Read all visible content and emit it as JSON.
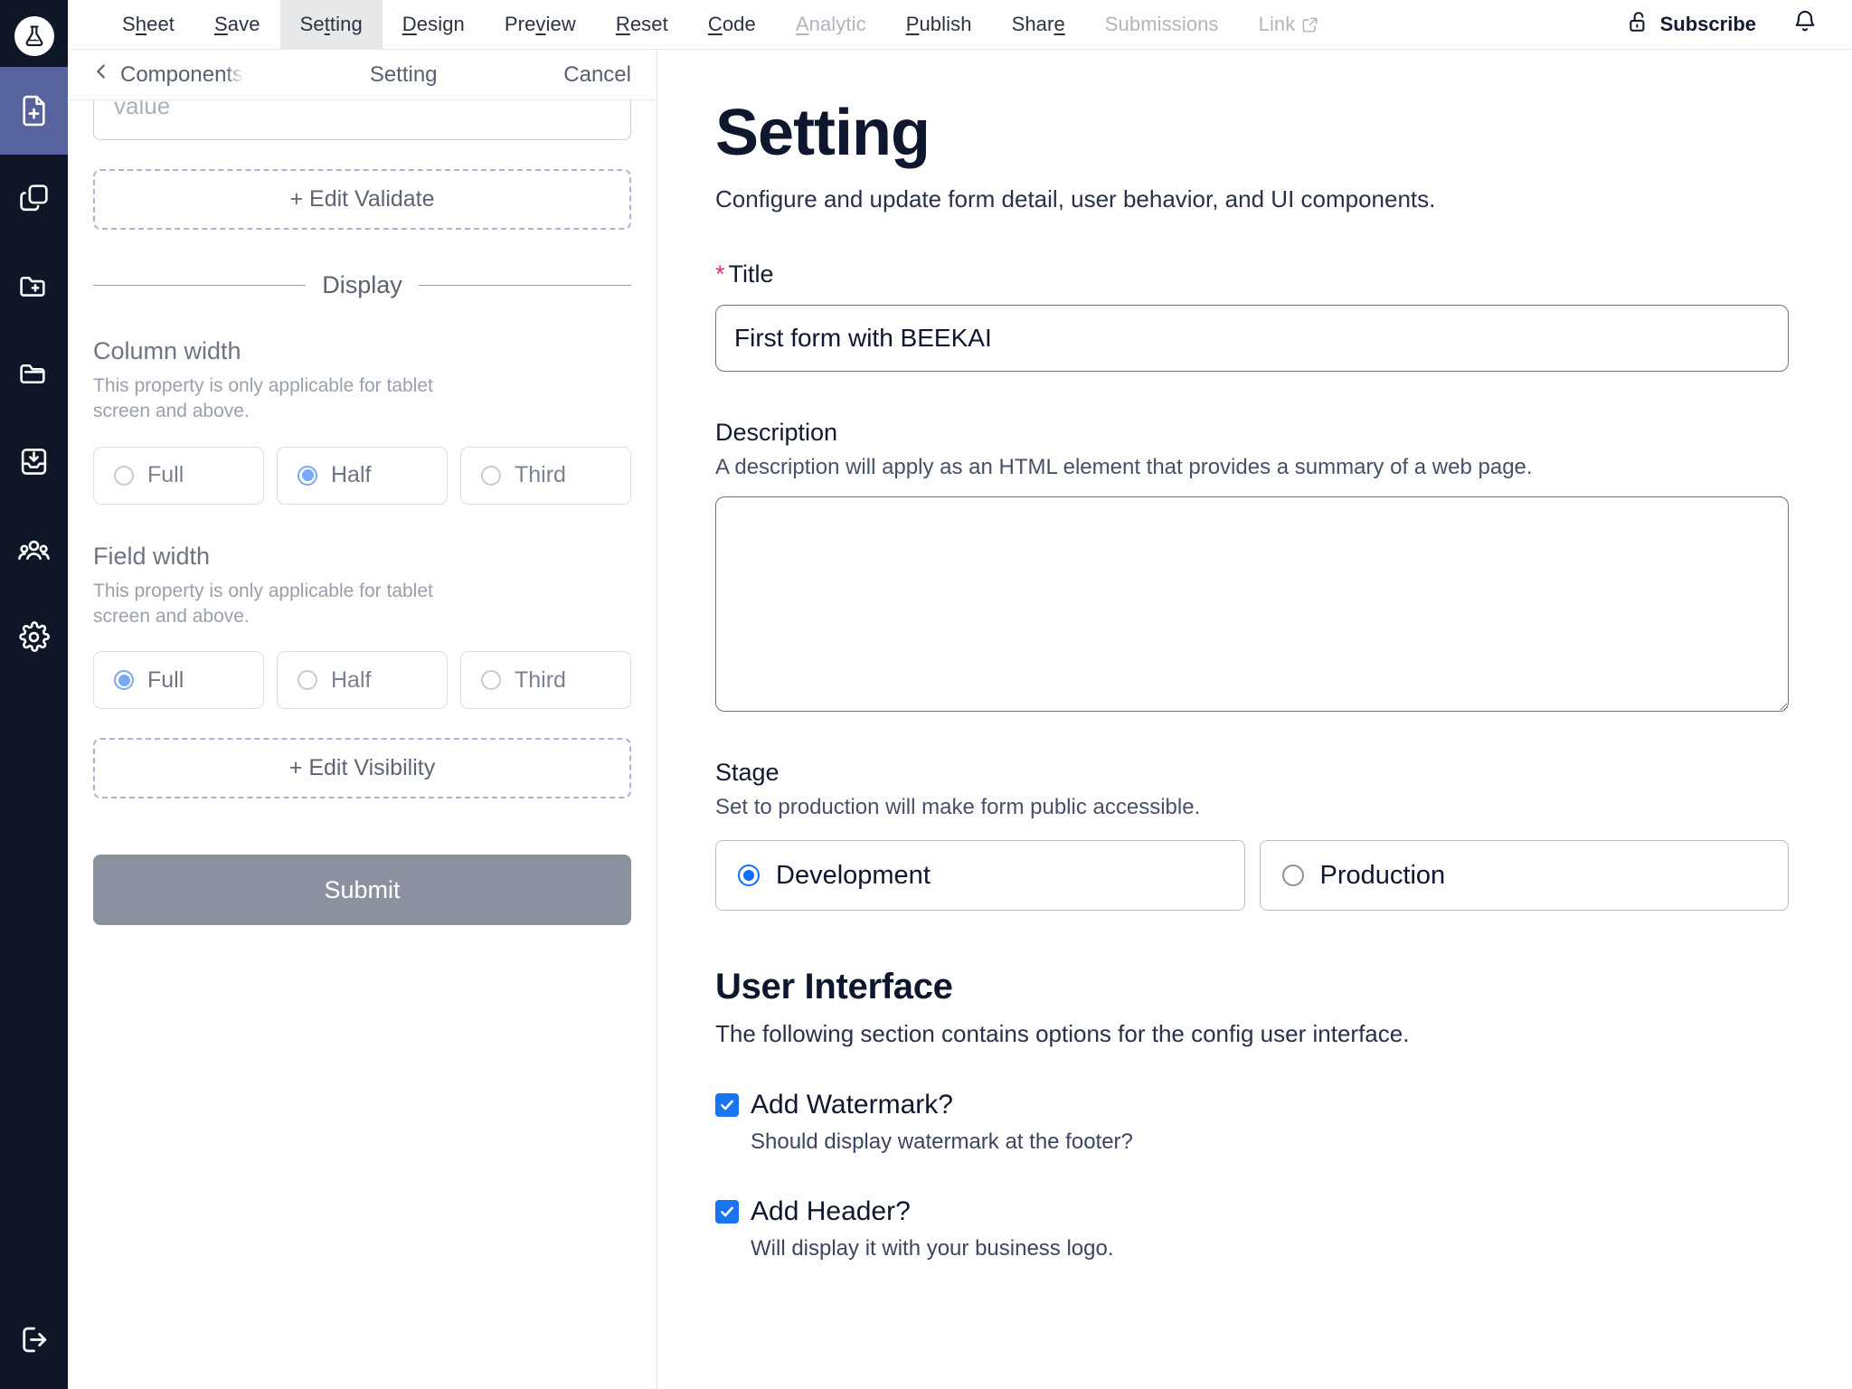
{
  "brand": {
    "logo_icon": "flask-icon"
  },
  "rail": {
    "items": [
      {
        "icon": "file-plus-icon",
        "name": "new-form",
        "active": true
      },
      {
        "icon": "copy-icon",
        "name": "duplicate",
        "active": false
      },
      {
        "icon": "folder-plus-icon",
        "name": "new-folder",
        "active": false
      },
      {
        "icon": "folder-icon",
        "name": "folders",
        "active": false
      },
      {
        "icon": "inbox-download-icon",
        "name": "inbox",
        "active": false
      },
      {
        "icon": "users-icon",
        "name": "team",
        "active": false
      },
      {
        "icon": "gear-icon",
        "name": "settings",
        "active": false
      }
    ],
    "bottom": {
      "icon": "logout-icon",
      "name": "logout"
    }
  },
  "topbar": {
    "items": [
      {
        "label": "Sheet",
        "accel": "h",
        "state": "enabled"
      },
      {
        "label": "Save",
        "accel": "S",
        "state": "enabled"
      },
      {
        "label": "Setting",
        "accel": "t",
        "state": "active"
      },
      {
        "label": "Design",
        "accel": "D",
        "state": "enabled"
      },
      {
        "label": "Preview",
        "accel": "v",
        "state": "enabled"
      },
      {
        "label": "Reset",
        "accel": "R",
        "state": "enabled"
      },
      {
        "label": "Code",
        "accel": "C",
        "state": "enabled"
      },
      {
        "label": "Analytic",
        "accel": "A",
        "state": "disabled"
      },
      {
        "label": "Publish",
        "accel": "P",
        "state": "enabled"
      },
      {
        "label": "Share",
        "accel": "e",
        "state": "enabled"
      },
      {
        "label": "Submissions",
        "accel": "",
        "state": "disabled"
      },
      {
        "label": "Link",
        "accel": "",
        "state": "disabled",
        "icon": "external-link-icon"
      }
    ],
    "subscribe_label": "Subscribe",
    "subscribe_icon": "unlock-icon",
    "bell_icon": "bell-icon"
  },
  "panel": {
    "back_label": "Components",
    "back_icon": "chevron-left-icon",
    "title": "Setting",
    "cancel_label": "Cancel",
    "value_input_placeholder": "value",
    "edit_validate_label": "+ Edit Validate",
    "display_divider_label": "Display",
    "column_width": {
      "title": "Column width",
      "note": "This property is only applicable for tablet screen and above.",
      "options": [
        "Full",
        "Half",
        "Third"
      ],
      "selected": "Half"
    },
    "field_width": {
      "title": "Field width",
      "note": "This property is only applicable for tablet screen and above.",
      "options": [
        "Full",
        "Half",
        "Third"
      ],
      "selected": "Full"
    },
    "edit_visibility_label": "+ Edit Visibility",
    "submit_label": "Submit"
  },
  "main": {
    "title": "Setting",
    "subtitle": "Configure and update form detail, user behavior, and UI components.",
    "title_field": {
      "label": "Title",
      "required_mark": "*",
      "value": "First form with BEEKAI",
      "placeholder": ""
    },
    "description_field": {
      "label": "Description",
      "desc": "A description will apply as an HTML element that provides a summary of a web page.",
      "value": "",
      "placeholder": ""
    },
    "stage": {
      "label": "Stage",
      "desc": "Set to production will make form public accessible.",
      "options": [
        "Development",
        "Production"
      ],
      "selected": "Development"
    },
    "user_interface": {
      "heading": "User Interface",
      "desc": "The following section contains options for the config user interface.",
      "checkboxes": [
        {
          "label": "Add Watermark?",
          "note": "Should display watermark at the footer?",
          "checked": true
        },
        {
          "label": "Add Header?",
          "note": "Will display it with your business logo.",
          "checked": true
        }
      ]
    }
  },
  "colors": {
    "rail_bg": "#0e1628",
    "rail_active": "#56639c",
    "accent_blue": "#0d6efd",
    "checkbox_blue": "#1a73f0",
    "soft_blue": "#79a8f5",
    "required_pink": "#ec2d6e",
    "submit_gray": "#8b919f",
    "ink": "#0f172f"
  }
}
